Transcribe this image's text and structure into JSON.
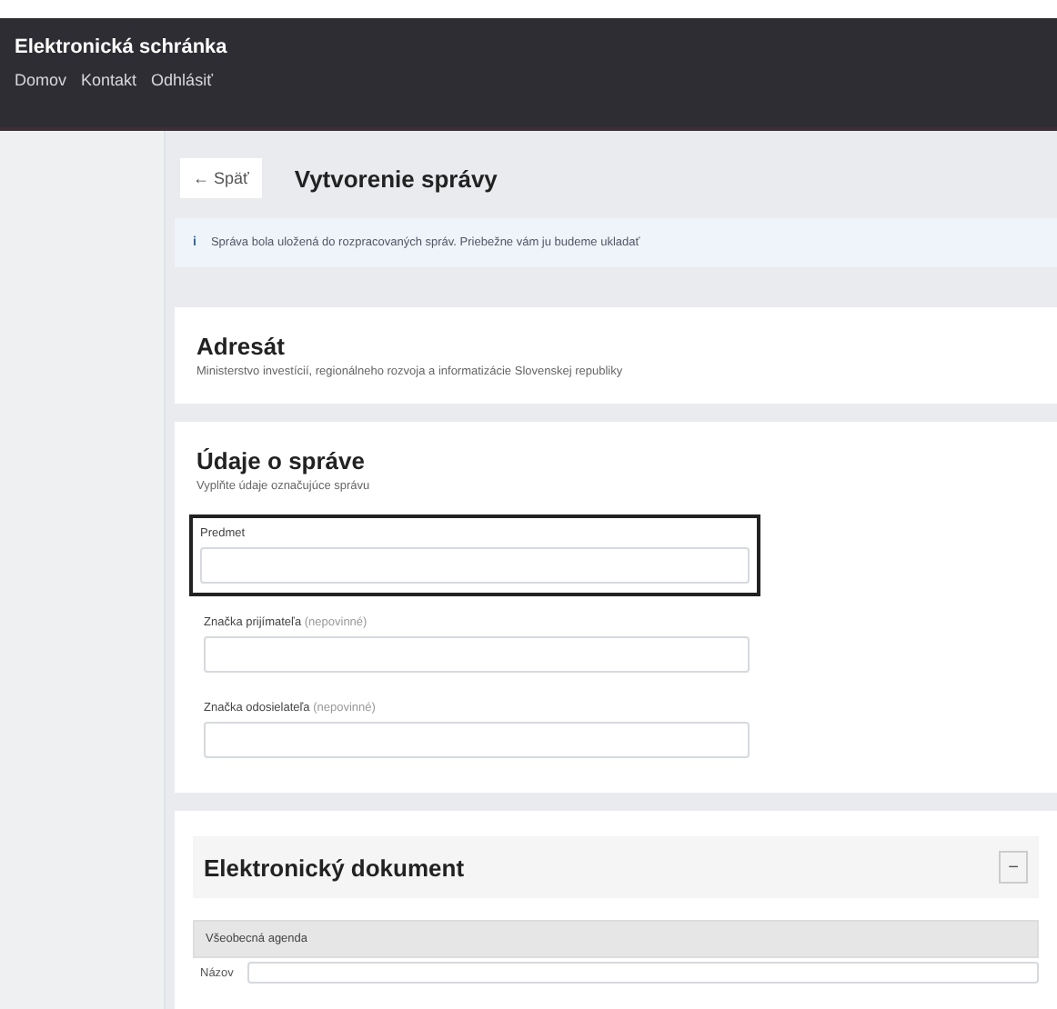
{
  "header": {
    "title": "Elektronická schránka",
    "nav": [
      "Domov",
      "Kontakt",
      "Odhlásiť"
    ]
  },
  "page": {
    "back": "← Späť",
    "title": "Vytvorenie správy"
  },
  "info": {
    "icon": "i",
    "text": "Správa bola uložená do rozpracovaných správ. Priebežne vám ju budeme ukladať"
  },
  "recipient": {
    "title": "Adresát",
    "description": "Ministerstvo investícií, regionálneho rozvoja a informatizácie Slovenskej republiky"
  },
  "message": {
    "title": "Údaje o správe",
    "description": "Vyplňte údaje označujúce správu",
    "fields": [
      {
        "label": "Predmet",
        "focused": true
      },
      {
        "label": "Značka prijímateľa",
        "optional": "(nepovinné)",
        "focused": false
      },
      {
        "label": "Značka odosielateľa",
        "optional": "(nepovinné)",
        "focused": false
      }
    ]
  },
  "document": {
    "title": "Elektronický dokument",
    "toggle": "−",
    "panel": {
      "title": "Všeobecná agenda",
      "field_label": "Názov"
    }
  }
}
